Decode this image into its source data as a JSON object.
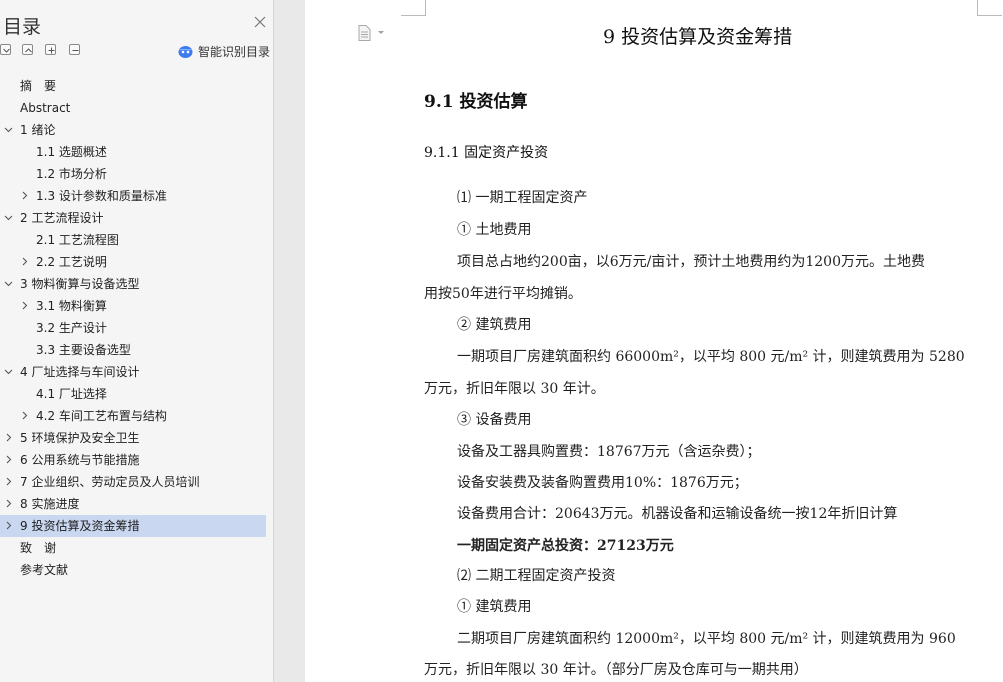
{
  "sidebar": {
    "title": "目录",
    "smart_toc_label": "智能识别目录",
    "items": [
      {
        "label": "摘　要",
        "level": 0,
        "arrow": "none"
      },
      {
        "label": "Abstract",
        "level": 0,
        "arrow": "none"
      },
      {
        "label": "1 绪论",
        "level": 0,
        "arrow": "down"
      },
      {
        "label": "1.1 选题概述",
        "level": 1,
        "arrow": "none"
      },
      {
        "label": "1.2 市场分析",
        "level": 1,
        "arrow": "none"
      },
      {
        "label": "1.3 设计参数和质量标准",
        "level": 1,
        "arrow": "right"
      },
      {
        "label": "2 工艺流程设计",
        "level": 0,
        "arrow": "down"
      },
      {
        "label": "2.1 工艺流程图",
        "level": 1,
        "arrow": "none"
      },
      {
        "label": "2.2 工艺说明",
        "level": 1,
        "arrow": "right"
      },
      {
        "label": "3 物料衡算与设备选型",
        "level": 0,
        "arrow": "down"
      },
      {
        "label": "3.1 物料衡算",
        "level": 1,
        "arrow": "right"
      },
      {
        "label": "3.2 生产设计",
        "level": 1,
        "arrow": "none"
      },
      {
        "label": "3.3 主要设备选型",
        "level": 1,
        "arrow": "none"
      },
      {
        "label": "4 厂址选择与车间设计",
        "level": 0,
        "arrow": "down"
      },
      {
        "label": "4.1 厂址选择",
        "level": 1,
        "arrow": "none"
      },
      {
        "label": "4.2 车间工艺布置与结构",
        "level": 1,
        "arrow": "right"
      },
      {
        "label": "5 环境保护及安全卫生",
        "level": 0,
        "arrow": "right"
      },
      {
        "label": "6 公用系统与节能措施",
        "level": 0,
        "arrow": "right"
      },
      {
        "label": "7 企业组织、劳动定员及人员培训",
        "level": 0,
        "arrow": "right"
      },
      {
        "label": "8 实施进度",
        "level": 0,
        "arrow": "right"
      },
      {
        "label": "9 投资估算及资金筹措",
        "level": 0,
        "arrow": "right",
        "selected": true
      },
      {
        "label": "致　谢",
        "level": 0,
        "arrow": "none"
      },
      {
        "label": "参考文献",
        "level": 0,
        "arrow": "none"
      }
    ]
  },
  "document": {
    "h1": "9 投资估算及资金筹措",
    "h2": "9.1 投资估算",
    "h3": "9.1.1  固定资产投资",
    "lines": [
      {
        "text": "⑴ 一期工程固定资产",
        "indent": true,
        "bold": false
      },
      {
        "text": "① 土地费用",
        "indent": true,
        "bold": false
      },
      {
        "text": "项目总占地约200亩，以6万元/亩计，预计土地费用约为1200万元。土地费",
        "indent": true,
        "bold": false
      },
      {
        "text": "用按50年进行平均摊销。",
        "indent": false,
        "bold": false
      },
      {
        "text": "② 建筑费用",
        "indent": true,
        "bold": false
      },
      {
        "text": "一期项目厂房建筑面积约 66000m²，以平均 800 元/m² 计，则建筑费用为 5280",
        "indent": true,
        "bold": false
      },
      {
        "text": "万元，折旧年限以 30 年计。",
        "indent": false,
        "bold": false
      },
      {
        "text": "③ 设备费用",
        "indent": true,
        "bold": false
      },
      {
        "text": "设备及工器具购置费：18767万元（含运杂费）；",
        "indent": true,
        "bold": false
      },
      {
        "text": "设备安装费及装备购置费用10%：1876万元；",
        "indent": true,
        "bold": false
      },
      {
        "text": "设备费用合计：20643万元。机器设备和运输设备统一按12年折旧计算",
        "indent": true,
        "bold": false
      },
      {
        "text": "一期固定资产总投资：27123万元",
        "indent": true,
        "bold": true
      },
      {
        "text": "⑵ 二期工程固定资产投资",
        "indent": true,
        "bold": false
      },
      {
        "text": "① 建筑费用",
        "indent": true,
        "bold": false
      },
      {
        "text": "二期项目厂房建筑面积约 12000m²，以平均 800 元/m² 计，则建筑费用为 960",
        "indent": true,
        "bold": false
      },
      {
        "text": "万元，折旧年限以 30 年计。（部分厂房及仓库可与一期共用）",
        "indent": false,
        "bold": false
      }
    ]
  }
}
